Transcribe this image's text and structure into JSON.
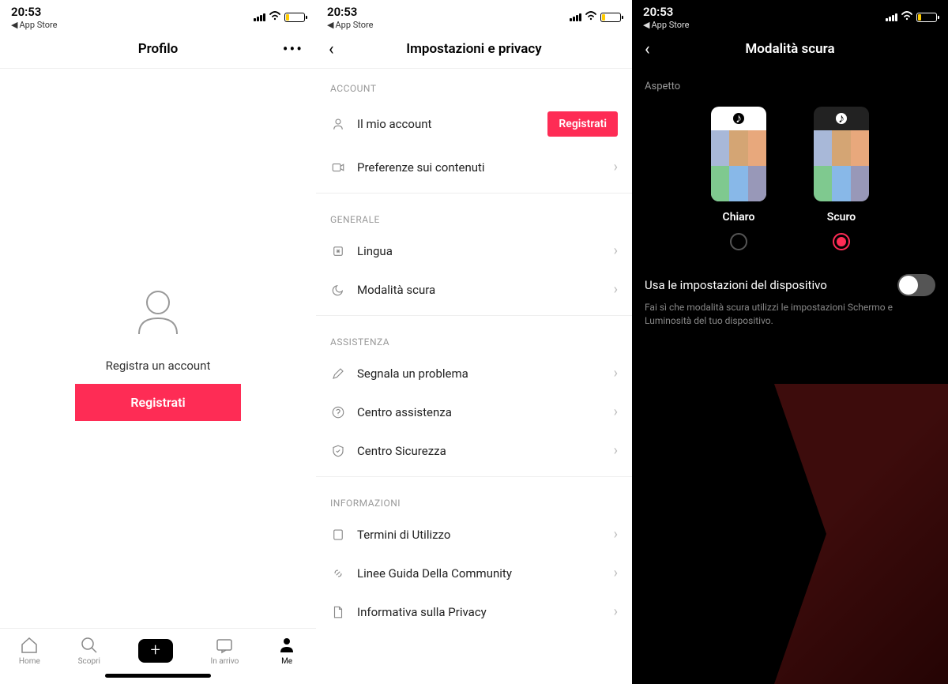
{
  "status": {
    "time": "20:53",
    "back_app": "App Store"
  },
  "colors": {
    "accent": "#fe2c55"
  },
  "screen1": {
    "title": "Profilo",
    "register_prompt": "Registra un account",
    "register_btn": "Registrati",
    "nav": {
      "home": "Home",
      "discover": "Scopri",
      "inbox": "In arrivo",
      "me": "Me"
    }
  },
  "screen2": {
    "title": "Impostazioni e privacy",
    "sections": {
      "account": "ACCOUNT",
      "generale": "GENERALE",
      "assistenza": "ASSISTENZA",
      "informazioni": "INFORMAZIONI"
    },
    "rows": {
      "my_account": "Il mio account",
      "content_pref": "Preferenze sui contenuti",
      "language": "Lingua",
      "dark_mode": "Modalità scura",
      "report": "Segnala un problema",
      "help_center": "Centro assistenza",
      "safety": "Centro Sicurezza",
      "terms": "Termini di Utilizzo",
      "guidelines": "Linee Guida Della Community",
      "privacy": "Informativa sulla Privacy"
    },
    "register_badge": "Registrati"
  },
  "screen3": {
    "title": "Modalità scura",
    "aspect_label": "Aspetto",
    "option_light": "Chiaro",
    "option_dark": "Scuro",
    "selected": "dark",
    "toggle_label": "Usa le impostazioni del dispositivo",
    "toggle_desc": "Fai sì che modalità scura utilizzi le impostazioni Schermo e Luminosità del tuo dispositivo."
  }
}
